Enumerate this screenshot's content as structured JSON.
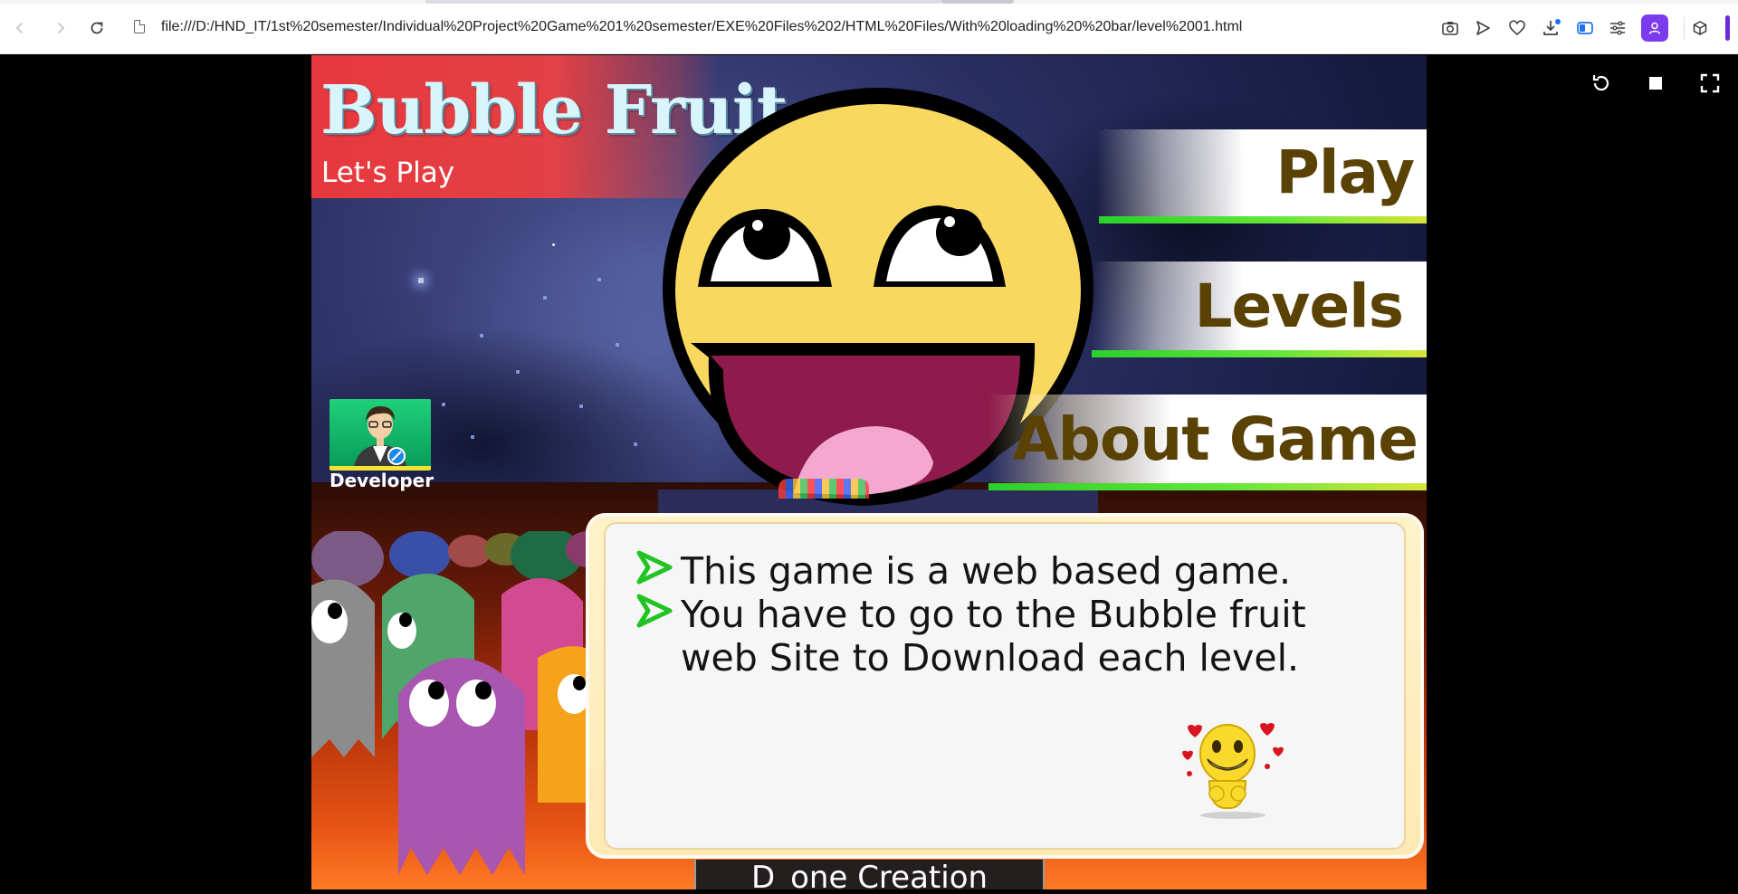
{
  "browser": {
    "url": "file:///D:/HND_IT/1st%20semester/Individual%20Project%20Game%201%20semester/EXE%20Files%202/HTML%20Files/With%20loading%20%20bar/level%2001.html",
    "icons": [
      "back-icon",
      "forward-icon",
      "reload-icon",
      "file-icon",
      "camera-icon",
      "send-icon",
      "heart-icon",
      "download-icon",
      "sidebar-icon",
      "tabs-icon",
      "profile-icon",
      "extension-icon"
    ],
    "profile_color": "#7c3aed"
  },
  "viewer": {
    "icons": [
      "restart-icon",
      "stop-icon",
      "fullscreen-icon"
    ]
  },
  "game": {
    "title": "Bubble Fruit",
    "subtitle": "Let's Play",
    "menu": [
      {
        "label": "Play"
      },
      {
        "label": "Levels"
      },
      {
        "label": "About Game"
      }
    ],
    "developer_label": "Developer",
    "about": {
      "points": [
        "This game is a web based game.",
        "You have to go to the Bubble fruit web Site to Download each level."
      ]
    },
    "footer": "D_one Creation",
    "colors": {
      "menu_text": "#5a4205",
      "title_banner": "#e7383d",
      "bullet_arrow": "#22c322"
    }
  }
}
